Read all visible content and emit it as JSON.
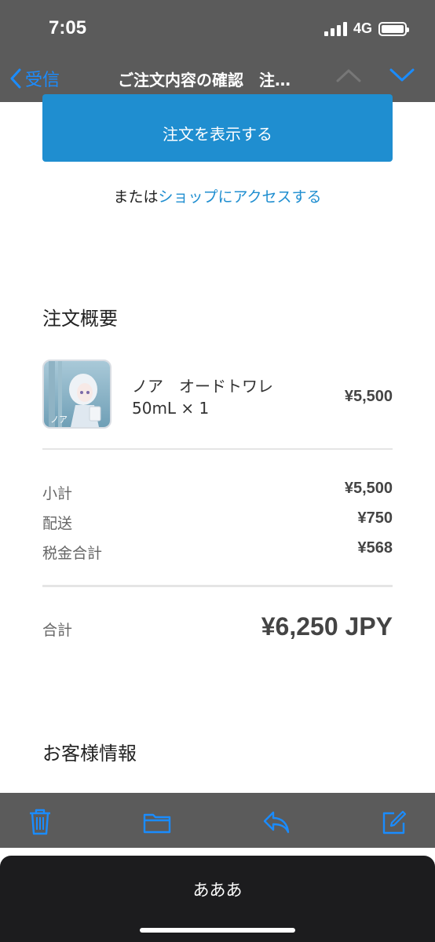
{
  "status": {
    "time": "7:05",
    "network": "4G"
  },
  "nav": {
    "back_label": "受信",
    "title": "ご注文内容の確認　注…"
  },
  "cta": {
    "label": "注文を表示する"
  },
  "alt": {
    "or_text": "または",
    "link_text": "ショップにアクセスする"
  },
  "summary": {
    "title": "注文概要",
    "item": {
      "name": "ノア　オードトワレ",
      "qty": "50mL × 1",
      "price": "¥5,500",
      "thumb_text": "ノア"
    },
    "rows": [
      {
        "label": "小計",
        "value": "¥5,500"
      },
      {
        "label": "配送",
        "value": "¥750"
      },
      {
        "label": "税金合計",
        "value": "¥568"
      }
    ],
    "total_label": "合計",
    "total_value": "¥6,250 JPY"
  },
  "customer": {
    "title": "お客様情報"
  },
  "toolbar": {
    "icons": [
      "trash-icon",
      "folder-icon",
      "reply-icon",
      "compose-icon"
    ]
  },
  "sheet": {
    "label": "あああ"
  },
  "colors": {
    "accent": "#1f8ed0",
    "header": "#5b5b5b",
    "sheet": "#1c1c1e"
  }
}
